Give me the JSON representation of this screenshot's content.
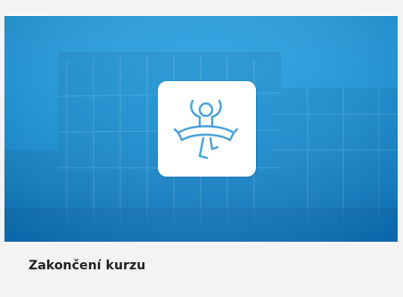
{
  "card": {
    "title": "Zakončení kurzu",
    "icon": "finish-line-runner-icon"
  },
  "colors": {
    "banner_blue": "#1b9be0",
    "icon_stroke": "#4aa3d8",
    "tile_bg": "#ffffff",
    "caption_text": "#222222"
  }
}
